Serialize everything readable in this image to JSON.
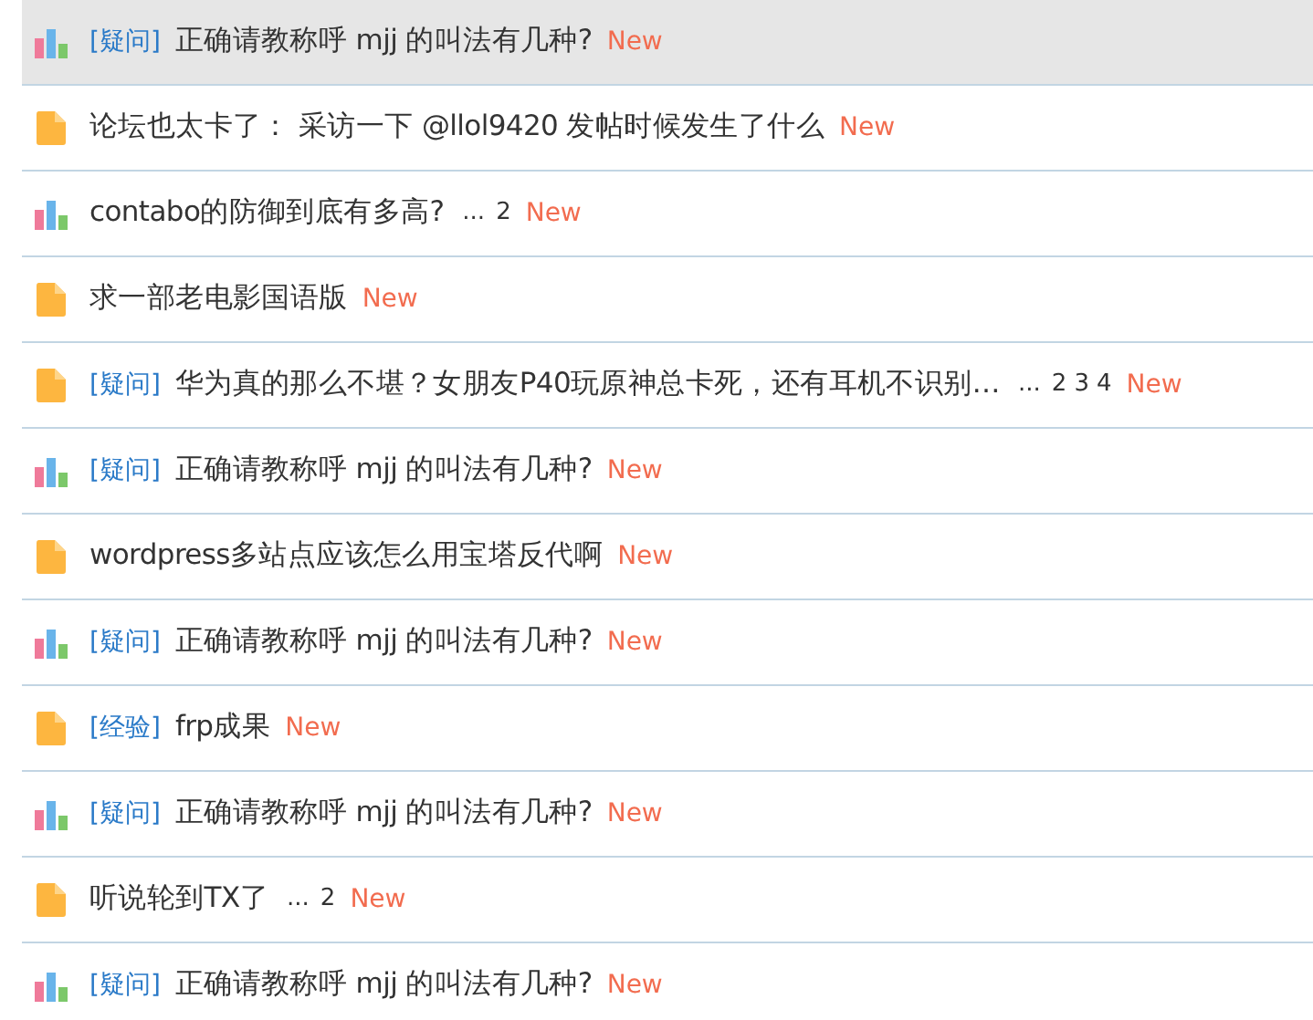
{
  "threads": [
    {
      "kind": "poll",
      "tag": "[疑问]",
      "title": "正确请教称呼 mjj 的叫法有几种?",
      "new": "New",
      "selected": true
    },
    {
      "kind": "doc",
      "title": "论坛也太卡了： 采访一下 @llol9420 发帖时候发生了什么",
      "new": "New",
      "selected": false
    },
    {
      "kind": "poll",
      "title": "contabo的防御到底有多高?",
      "pages": {
        "ellipsis": "...",
        "links": [
          "2"
        ]
      },
      "new": "New",
      "selected": false
    },
    {
      "kind": "doc",
      "title": "求一部老电影国语版",
      "new": "New",
      "selected": false
    },
    {
      "kind": "doc",
      "tag": "[疑问]",
      "title": "华为真的那么不堪？女朋友P40玩原神总卡死，还有耳机不识别…",
      "pages": {
        "ellipsis": "...",
        "links": [
          "2",
          "3",
          "4"
        ]
      },
      "new": "New",
      "selected": false
    },
    {
      "kind": "poll",
      "tag": "[疑问]",
      "title": "正确请教称呼 mjj 的叫法有几种?",
      "new": "New",
      "selected": false
    },
    {
      "kind": "doc",
      "title": "wordpress多站点应该怎么用宝塔反代啊",
      "new": "New",
      "selected": false
    },
    {
      "kind": "poll",
      "tag": "[疑问]",
      "title": "正确请教称呼 mjj 的叫法有几种?",
      "new": "New",
      "selected": false
    },
    {
      "kind": "doc",
      "tag": "[经验]",
      "title": "frp成果",
      "new": "New",
      "selected": false
    },
    {
      "kind": "poll",
      "tag": "[疑问]",
      "title": "正确请教称呼 mjj 的叫法有几种?",
      "new": "New",
      "selected": false
    },
    {
      "kind": "doc",
      "title": "听说轮到TX了",
      "pages": {
        "ellipsis": "...",
        "links": [
          "2"
        ]
      },
      "new": "New",
      "selected": false
    },
    {
      "kind": "poll",
      "tag": "[疑问]",
      "title": "正确请教称呼 mjj 的叫法有几种?",
      "new": "New",
      "selected": false
    }
  ]
}
